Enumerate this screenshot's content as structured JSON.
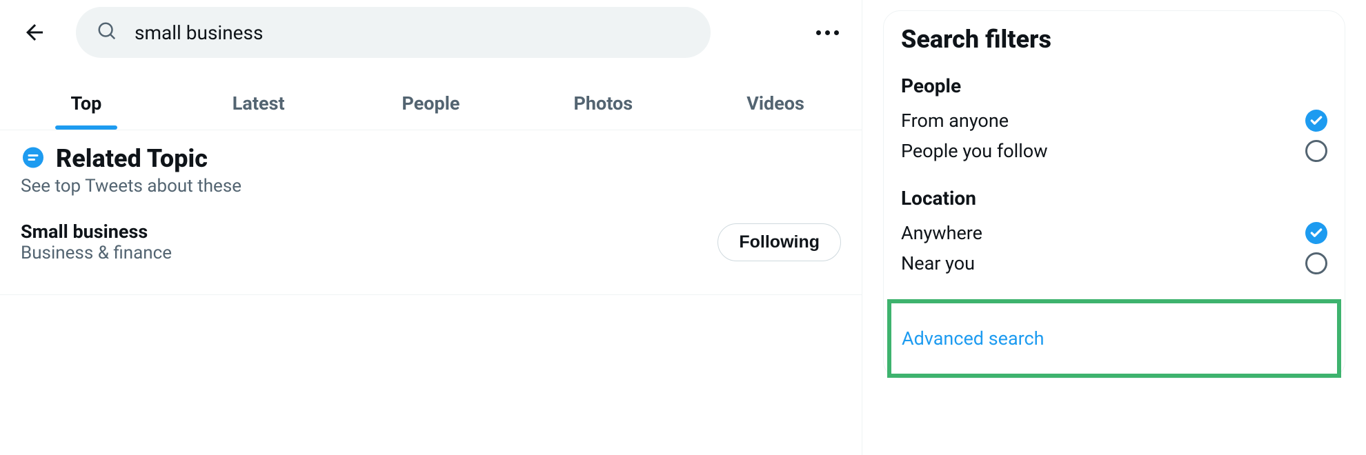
{
  "search": {
    "query": "small business"
  },
  "tabs": [
    {
      "label": "Top",
      "active": true
    },
    {
      "label": "Latest",
      "active": false
    },
    {
      "label": "People",
      "active": false
    },
    {
      "label": "Photos",
      "active": false
    },
    {
      "label": "Videos",
      "active": false
    }
  ],
  "related": {
    "title": "Related Topic",
    "subtitle": "See top Tweets about these",
    "topic": {
      "name": "Small business",
      "category": "Business & finance",
      "button": "Following"
    }
  },
  "filters": {
    "title": "Search filters",
    "people": {
      "title": "People",
      "options": [
        {
          "label": "From anyone",
          "checked": true
        },
        {
          "label": "People you follow",
          "checked": false
        }
      ]
    },
    "location": {
      "title": "Location",
      "options": [
        {
          "label": "Anywhere",
          "checked": true
        },
        {
          "label": "Near you",
          "checked": false
        }
      ]
    },
    "advanced": "Advanced search"
  }
}
